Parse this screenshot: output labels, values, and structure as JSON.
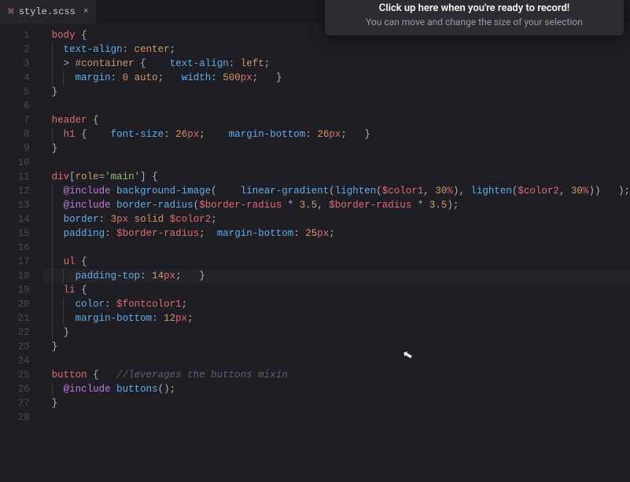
{
  "tab": {
    "filename": "style.scss",
    "close_glyph": "×",
    "icon_glyph": "⌘"
  },
  "tooltip": {
    "title": "Click up here when you're ready to record!",
    "subtitle": "You can move and change the size of your selection"
  },
  "code": {
    "lines": [
      {
        "n": "1",
        "t": [
          [
            "tag",
            "body"
          ],
          [
            "p",
            " "
          ],
          [
            "punct",
            "{"
          ]
        ]
      },
      {
        "n": "2",
        "indent": [
          1
        ],
        "t": [
          [
            "p",
            "  "
          ],
          [
            "prop",
            "text-align"
          ],
          [
            "punct",
            ": "
          ],
          [
            "val",
            "center"
          ],
          [
            "punct",
            ";"
          ]
        ]
      },
      {
        "n": "3",
        "indent": [
          1
        ],
        "t": [
          [
            "p",
            "  "
          ],
          [
            "punct",
            "> "
          ],
          [
            "idsel",
            "#container"
          ],
          [
            "p",
            " "
          ],
          [
            "punct",
            "{"
          ],
          [
            "p",
            "    "
          ],
          [
            "prop",
            "text-align"
          ],
          [
            "punct",
            ": "
          ],
          [
            "val",
            "left"
          ],
          [
            "punct",
            ";"
          ]
        ]
      },
      {
        "n": "4",
        "indent": [
          1,
          2
        ],
        "t": [
          [
            "p",
            "    "
          ],
          [
            "prop",
            "margin"
          ],
          [
            "punct",
            ": "
          ],
          [
            "num",
            "0"
          ],
          [
            "p",
            " "
          ],
          [
            "val",
            "auto"
          ],
          [
            "punct",
            ";"
          ],
          [
            "p",
            "   "
          ],
          [
            "prop",
            "width"
          ],
          [
            "punct",
            ": "
          ],
          [
            "num",
            "500"
          ],
          [
            "unit",
            "px"
          ],
          [
            "punct",
            ";"
          ],
          [
            "p",
            "   "
          ],
          [
            "punct",
            "}"
          ]
        ]
      },
      {
        "n": "5",
        "t": [
          [
            "punct",
            "}"
          ]
        ]
      },
      {
        "n": "6",
        "t": []
      },
      {
        "n": "7",
        "t": [
          [
            "tag",
            "header"
          ],
          [
            "p",
            " "
          ],
          [
            "punct",
            "{"
          ]
        ]
      },
      {
        "n": "8",
        "indent": [
          1
        ],
        "t": [
          [
            "p",
            "  "
          ],
          [
            "tag",
            "h1"
          ],
          [
            "p",
            " "
          ],
          [
            "punct",
            "{"
          ],
          [
            "p",
            "    "
          ],
          [
            "prop",
            "font-size"
          ],
          [
            "punct",
            ": "
          ],
          [
            "num",
            "26"
          ],
          [
            "unit",
            "px"
          ],
          [
            "punct",
            ";"
          ],
          [
            "p",
            "    "
          ],
          [
            "prop",
            "margin-bottom"
          ],
          [
            "punct",
            ": "
          ],
          [
            "num",
            "26"
          ],
          [
            "unit",
            "px"
          ],
          [
            "punct",
            ";"
          ],
          [
            "p",
            "   "
          ],
          [
            "punct",
            "}"
          ]
        ]
      },
      {
        "n": "9",
        "t": [
          [
            "punct",
            "}"
          ]
        ]
      },
      {
        "n": "10",
        "t": []
      },
      {
        "n": "11",
        "t": [
          [
            "tag",
            "div"
          ],
          [
            "punct",
            "["
          ],
          [
            "attr",
            "role"
          ],
          [
            "punct",
            "="
          ],
          [
            "str",
            "'main'"
          ],
          [
            "punct",
            "]"
          ],
          [
            "p",
            " "
          ],
          [
            "punct",
            "{"
          ]
        ]
      },
      {
        "n": "12",
        "indent": [
          1
        ],
        "t": [
          [
            "p",
            "  "
          ],
          [
            "kw",
            "@include"
          ],
          [
            "p",
            " "
          ],
          [
            "func",
            "background-image"
          ],
          [
            "punct",
            "("
          ],
          [
            "p",
            "    "
          ],
          [
            "func",
            "linear-gradient"
          ],
          [
            "punct",
            "("
          ],
          [
            "func",
            "lighten"
          ],
          [
            "punct",
            "("
          ],
          [
            "var",
            "$color1"
          ],
          [
            "punct",
            ", "
          ],
          [
            "num",
            "30"
          ],
          [
            "unit",
            "%"
          ],
          [
            "punct",
            "), "
          ],
          [
            "func",
            "lighten"
          ],
          [
            "punct",
            "("
          ],
          [
            "var",
            "$color2"
          ],
          [
            "punct",
            ", "
          ],
          [
            "num",
            "30"
          ],
          [
            "unit",
            "%"
          ],
          [
            "punct",
            "))"
          ],
          [
            "p",
            "   "
          ],
          [
            "punct",
            ");"
          ]
        ]
      },
      {
        "n": "13",
        "indent": [
          1
        ],
        "t": [
          [
            "p",
            "  "
          ],
          [
            "kw",
            "@include"
          ],
          [
            "p",
            " "
          ],
          [
            "func",
            "border-radius"
          ],
          [
            "punct",
            "("
          ],
          [
            "var",
            "$border-radius"
          ],
          [
            "p",
            " "
          ],
          [
            "punct",
            "*"
          ],
          [
            "p",
            " "
          ],
          [
            "num",
            "3.5"
          ],
          [
            "punct",
            ", "
          ],
          [
            "var",
            "$border-radius"
          ],
          [
            "p",
            " "
          ],
          [
            "punct",
            "*"
          ],
          [
            "p",
            " "
          ],
          [
            "num",
            "3.5"
          ],
          [
            "punct",
            ");"
          ]
        ]
      },
      {
        "n": "14",
        "indent": [
          1
        ],
        "t": [
          [
            "p",
            "  "
          ],
          [
            "prop",
            "border"
          ],
          [
            "punct",
            ": "
          ],
          [
            "num",
            "3"
          ],
          [
            "unit",
            "px"
          ],
          [
            "p",
            " "
          ],
          [
            "val",
            "solid"
          ],
          [
            "p",
            " "
          ],
          [
            "var",
            "$color2"
          ],
          [
            "punct",
            ";"
          ]
        ]
      },
      {
        "n": "15",
        "indent": [
          1
        ],
        "t": [
          [
            "p",
            "  "
          ],
          [
            "prop",
            "padding"
          ],
          [
            "punct",
            ": "
          ],
          [
            "var",
            "$border-radius"
          ],
          [
            "punct",
            ";"
          ],
          [
            "p",
            "  "
          ],
          [
            "prop",
            "margin-bottom"
          ],
          [
            "punct",
            ": "
          ],
          [
            "num",
            "25"
          ],
          [
            "unit",
            "px"
          ],
          [
            "punct",
            ";"
          ]
        ]
      },
      {
        "n": "16",
        "indent": [
          1
        ],
        "t": []
      },
      {
        "n": "17",
        "indent": [
          1
        ],
        "t": [
          [
            "p",
            "  "
          ],
          [
            "tag",
            "ul"
          ],
          [
            "p",
            " "
          ],
          [
            "punct",
            "{"
          ]
        ]
      },
      {
        "n": "18",
        "hl": true,
        "indent": [
          1,
          2
        ],
        "t": [
          [
            "p",
            "    "
          ],
          [
            "prop",
            "padding-top"
          ],
          [
            "punct",
            ": "
          ],
          [
            "num",
            "14"
          ],
          [
            "unit",
            "px"
          ],
          [
            "punct",
            ";"
          ],
          [
            "p",
            "   "
          ],
          [
            "punct",
            "}"
          ]
        ]
      },
      {
        "n": "19",
        "indent": [
          1
        ],
        "t": [
          [
            "p",
            "  "
          ],
          [
            "tag",
            "li"
          ],
          [
            "p",
            " "
          ],
          [
            "punct",
            "{"
          ]
        ]
      },
      {
        "n": "20",
        "indent": [
          1,
          2
        ],
        "t": [
          [
            "p",
            "    "
          ],
          [
            "prop",
            "color"
          ],
          [
            "punct",
            ": "
          ],
          [
            "var",
            "$fontcolor1"
          ],
          [
            "punct",
            ";"
          ]
        ]
      },
      {
        "n": "21",
        "indent": [
          1,
          2
        ],
        "t": [
          [
            "p",
            "    "
          ],
          [
            "prop",
            "margin-bottom"
          ],
          [
            "punct",
            ": "
          ],
          [
            "num",
            "12"
          ],
          [
            "unit",
            "px"
          ],
          [
            "punct",
            ";"
          ]
        ]
      },
      {
        "n": "22",
        "indent": [
          1
        ],
        "t": [
          [
            "p",
            "  "
          ],
          [
            "punct",
            "}"
          ]
        ]
      },
      {
        "n": "23",
        "t": [
          [
            "punct",
            "}"
          ]
        ]
      },
      {
        "n": "24",
        "t": []
      },
      {
        "n": "25",
        "t": [
          [
            "tag",
            "button"
          ],
          [
            "p",
            " "
          ],
          [
            "punct",
            "{"
          ],
          [
            "p",
            "   "
          ],
          [
            "cmt",
            "//leverages the buttons mixin"
          ]
        ]
      },
      {
        "n": "26",
        "indent": [
          1
        ],
        "t": [
          [
            "p",
            "  "
          ],
          [
            "kw",
            "@include"
          ],
          [
            "p",
            " "
          ],
          [
            "func",
            "buttons"
          ],
          [
            "punct",
            "();"
          ]
        ]
      },
      {
        "n": "27",
        "t": [
          [
            "punct",
            "}"
          ]
        ]
      },
      {
        "n": "28",
        "t": []
      }
    ]
  },
  "cursor_glyph": "⬉"
}
